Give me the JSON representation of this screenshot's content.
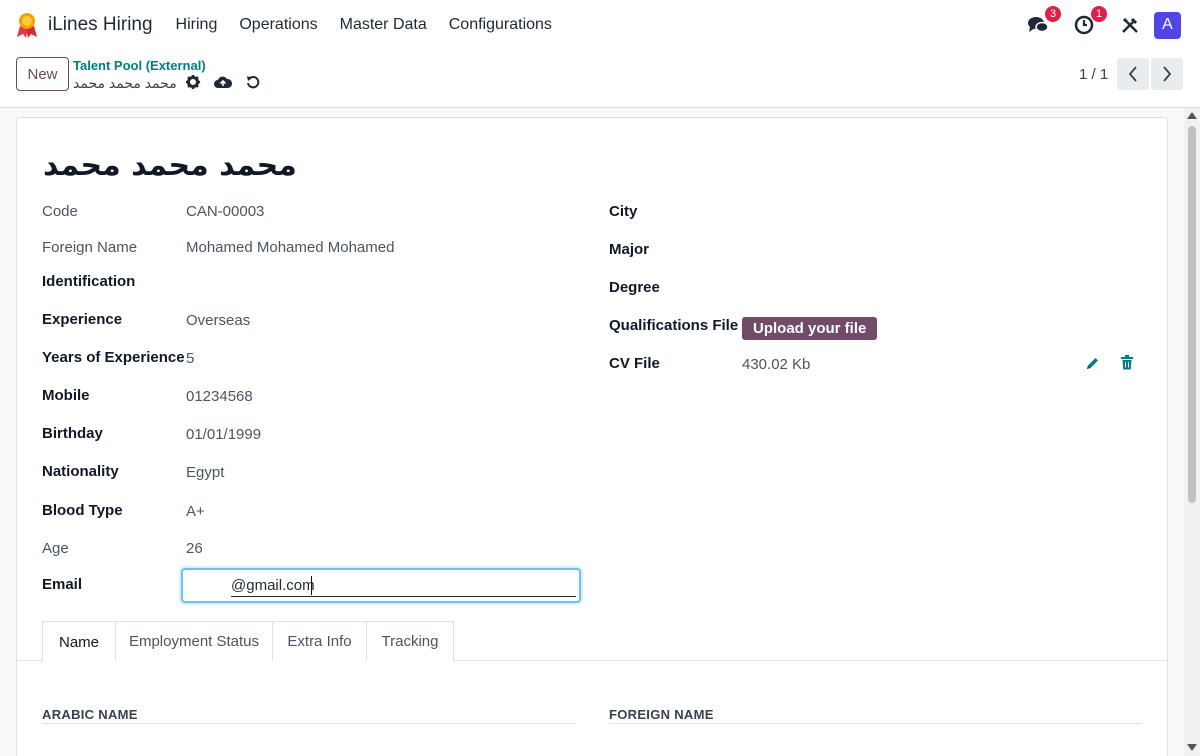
{
  "app": {
    "name": "iLines Hiring",
    "menu": [
      "Hiring",
      "Operations",
      "Master Data",
      "Configurations"
    ],
    "messages_count": "3",
    "activities_count": "1",
    "avatar_letter": "A",
    "accent_color": "#714b67",
    "avatar_color": "#4f46e5"
  },
  "control": {
    "new_label": "New",
    "breadcrumb_parent": "Talent Pool (External)",
    "breadcrumb_current": "محمد محمد محمد",
    "pager": "1 / 1"
  },
  "record": {
    "title": "محمد محمد محمد",
    "left_fields": [
      {
        "label": "Code",
        "value": "CAN-00003"
      },
      {
        "label": "Foreign Name",
        "value": "Mohamed Mohamed Mohamed"
      },
      {
        "label": "Identification",
        "value": ""
      },
      {
        "label": "Experience",
        "value": "Overseas"
      },
      {
        "label": "Years of Experience",
        "value": "5"
      },
      {
        "label": "Mobile",
        "value": "01234568"
      },
      {
        "label": "Birthday",
        "value": "01/01/1999"
      },
      {
        "label": "Nationality",
        "value": "Egypt"
      },
      {
        "label": "Blood Type",
        "value": "A+"
      },
      {
        "label": "Age",
        "value": "26"
      },
      {
        "label": "Email",
        "value": "@gmail.com"
      }
    ],
    "right_fields": [
      {
        "label": "City",
        "value": ""
      },
      {
        "label": "Major",
        "value": ""
      },
      {
        "label": "Degree",
        "value": ""
      },
      {
        "label": "Qualifications File",
        "value": ""
      },
      {
        "label": "CV File",
        "value": "430.02 Kb"
      }
    ],
    "upload_label": "Upload your file"
  },
  "tabs": [
    "Name",
    "Employment Status",
    "Extra Info",
    "Tracking"
  ],
  "sections": {
    "arabic_name": "ARABIC NAME",
    "foreign_name": "FOREIGN NAME"
  }
}
